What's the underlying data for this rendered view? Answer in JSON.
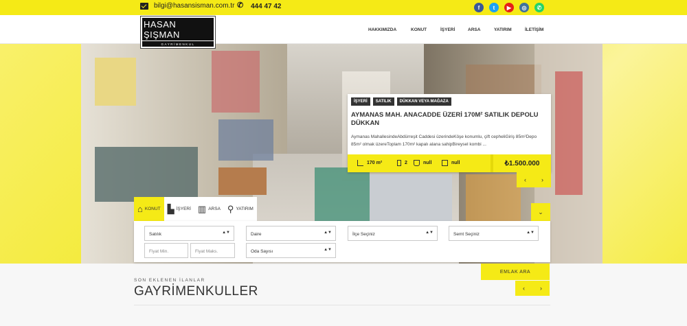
{
  "topbar": {
    "email": "bilgi@hasansisman.com.tr",
    "phone": "444 47 42",
    "social_icons": [
      "facebook-icon",
      "twitter-icon",
      "youtube-icon",
      "instagram-icon",
      "whatsapp-icon"
    ],
    "social_colors": [
      "#3b5998",
      "#1da1f2",
      "#e62117",
      "#3f729b",
      "#25d366"
    ]
  },
  "header": {
    "logo_main": "HASAN ŞIŞMAN",
    "logo_sub": "GAYRİMENKUL",
    "nav": [
      "HAKKIMIZDA",
      "KONUT",
      "İŞYERİ",
      "ARSA",
      "YATIRIM",
      "İLETİŞİM"
    ]
  },
  "listing": {
    "tags": [
      "İŞYERİ",
      "SATILIK",
      "DÜKKAN VEYA MAĞAZA"
    ],
    "title": "AYMANAS MAH. ANACADDE ÜZERİ 170M² SATILIK DEPOLU DÜKKAN",
    "description": "Aymanas MahallesindeAbdürreşit Caddesi üzerindeKöşe konumlu, çift cepheliGiriş 85m²Depo 85m² olmak üzereToplam 170m² kapalı alana sahipBireysel kombi ...",
    "area": "170 m²",
    "rooms": "2",
    "baths": "null",
    "floors": "null",
    "price": "₺1.500.000"
  },
  "search_tabs": [
    "KONUT",
    "İŞYERİ",
    "ARSA",
    "YATIRIM"
  ],
  "search": {
    "status": "Satılık",
    "type": "Daire",
    "district": "İlçe Seçiniz",
    "neighborhood": "Semt Seçiniz",
    "price_min": "Fiyat Min.",
    "price_max": "Fiyat Maks.",
    "rooms": "Oda Sayısı",
    "button": "EMLAK ARA"
  },
  "section": {
    "subtitle": "SON EKLENEN İLANLAR",
    "title": "GAYRİMENKULLER"
  },
  "colors": {
    "accent": "#f5ea16",
    "dark": "#333333"
  }
}
